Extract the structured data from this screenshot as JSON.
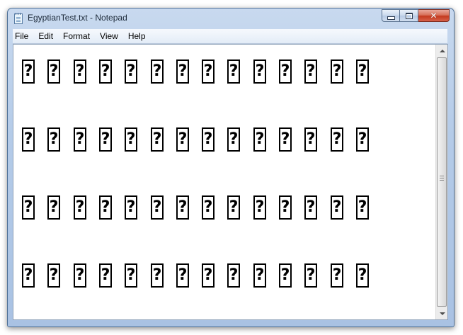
{
  "window": {
    "title": "EgyptianTest.txt - Notepad",
    "controls": {
      "minimize": "minimize",
      "maximize": "maximize",
      "close": "✕"
    }
  },
  "menubar": {
    "items": [
      "File",
      "Edit",
      "Format",
      "View",
      "Help"
    ]
  },
  "document": {
    "glyph_char": "?",
    "line_count": 4,
    "glyphs_per_line": 14
  },
  "colors": {
    "window_frame": "#b4cbe8",
    "close_button": "#c43a1f",
    "editor_background": "#ffffff",
    "text": "#000000"
  },
  "icons": [
    "notepad-icon",
    "minimize-icon",
    "maximize-icon",
    "close-icon",
    "scroll-up-arrow-icon",
    "scroll-down-arrow-icon"
  ]
}
